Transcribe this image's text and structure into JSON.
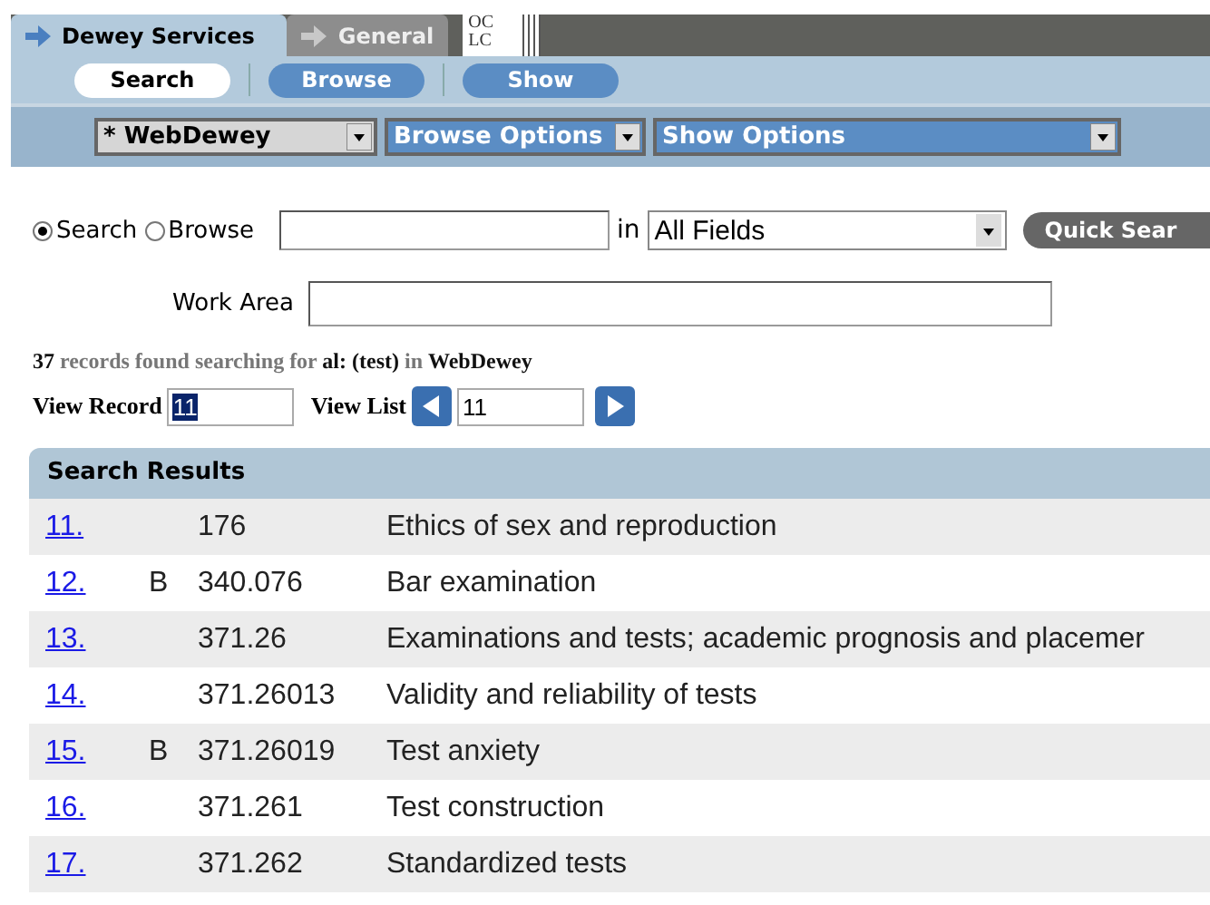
{
  "tabs": [
    {
      "label": "Dewey Services",
      "selected": true
    },
    {
      "label": "General",
      "selected": false
    }
  ],
  "logo_lines": [
    "OC",
    "LC"
  ],
  "nav": [
    {
      "label": "Search",
      "selected": true
    },
    {
      "label": "Browse",
      "selected": false
    },
    {
      "label": "Show",
      "selected": false
    }
  ],
  "options": [
    {
      "value": "* WebDewey",
      "kind": "gray"
    },
    {
      "value": "Browse Options",
      "kind": "blue"
    },
    {
      "value": "Show Options",
      "kind": "blue"
    }
  ],
  "search_form": {
    "modes": [
      {
        "label": "Search",
        "selected": true
      },
      {
        "label": "Browse",
        "selected": false
      }
    ],
    "in_label": "in",
    "field_select": "All Fields",
    "button": "Quick Sear",
    "work_area_label": "Work Area"
  },
  "summary": "**37** records found searching for **al: (test)** in **WebDewey**",
  "view_record": {
    "label": "View Record",
    "value": "11"
  },
  "view_list": {
    "label": "View List",
    "value": "11"
  },
  "results": {
    "title": "Search Results",
    "rows": [
      {
        "number": "11.",
        "flag": "",
        "code": "176",
        "caption": "Ethics of sex and reproduction"
      },
      {
        "number": "12.",
        "flag": "B",
        "code": "340.076",
        "caption": "Bar examination"
      },
      {
        "number": "13.",
        "flag": "",
        "code": "371.26",
        "caption": "Examinations and tests; academic prognosis and placemer"
      },
      {
        "number": "14.",
        "flag": "",
        "code": "371.26013",
        "caption": "Validity and reliability of tests"
      },
      {
        "number": "15.",
        "flag": "B",
        "code": "371.26019",
        "caption": "Test anxiety"
      },
      {
        "number": "16.",
        "flag": "",
        "code": "371.261",
        "caption": "Test construction"
      },
      {
        "number": "17.",
        "flag": "",
        "code": "371.262",
        "caption": "Standardized tests"
      }
    ]
  }
}
